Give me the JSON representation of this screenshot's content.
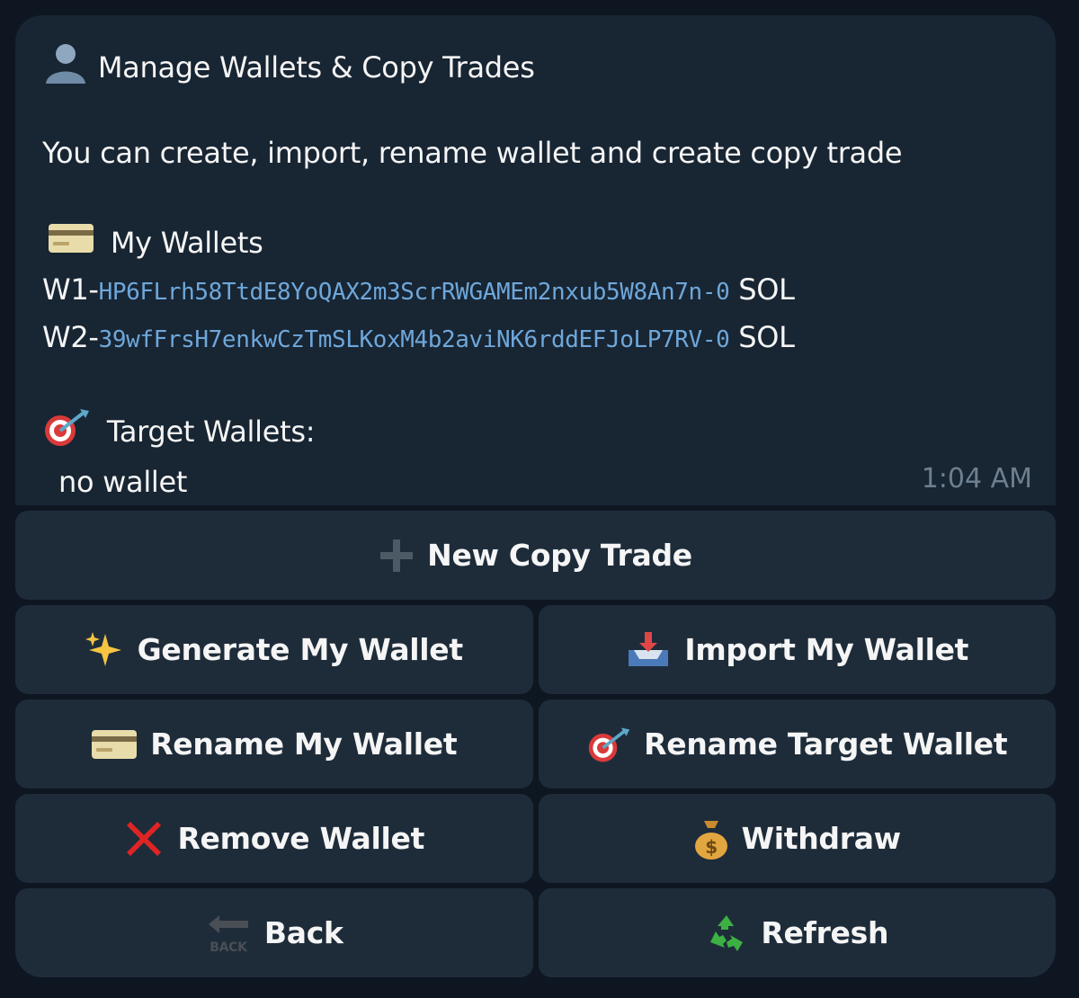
{
  "message": {
    "title": "Manage Wallets & Copy Trades",
    "description": "You can create, import, rename wallet and create copy trade",
    "my_wallets_label": "My Wallets",
    "wallets": [
      {
        "prefix": "W1-",
        "address": "HP6FLrh58TtdE8YoQAX2m3ScrRWGAMEm2nxub5W8An7n",
        "balance": "-0",
        "unit": " SOL"
      },
      {
        "prefix": "W2-",
        "address": "39wfFrsH7enkwCzTmSLKoxM4b2aviNK6rddEFJoLP7RV",
        "balance": "-0",
        "unit": " SOL"
      }
    ],
    "target_wallets_label": "Target Wallets:",
    "target_wallets_value": "no wallet",
    "time": "1:04 AM"
  },
  "buttons": {
    "new_copy_trade": "New Copy Trade",
    "generate_wallet": "Generate My Wallet",
    "import_wallet": "Import My Wallet",
    "rename_wallet": "Rename My Wallet",
    "rename_target": "Rename Target Wallet",
    "remove_wallet": "Remove Wallet",
    "withdraw": "Withdraw",
    "back": "Back",
    "refresh": "Refresh",
    "back_icon_text": "BACK"
  },
  "colors": {
    "background": "#0e1621",
    "bubble": "#182533",
    "button": "#1e2c3a",
    "link": "#6ea7da",
    "timestamp": "#6d7f8f"
  }
}
